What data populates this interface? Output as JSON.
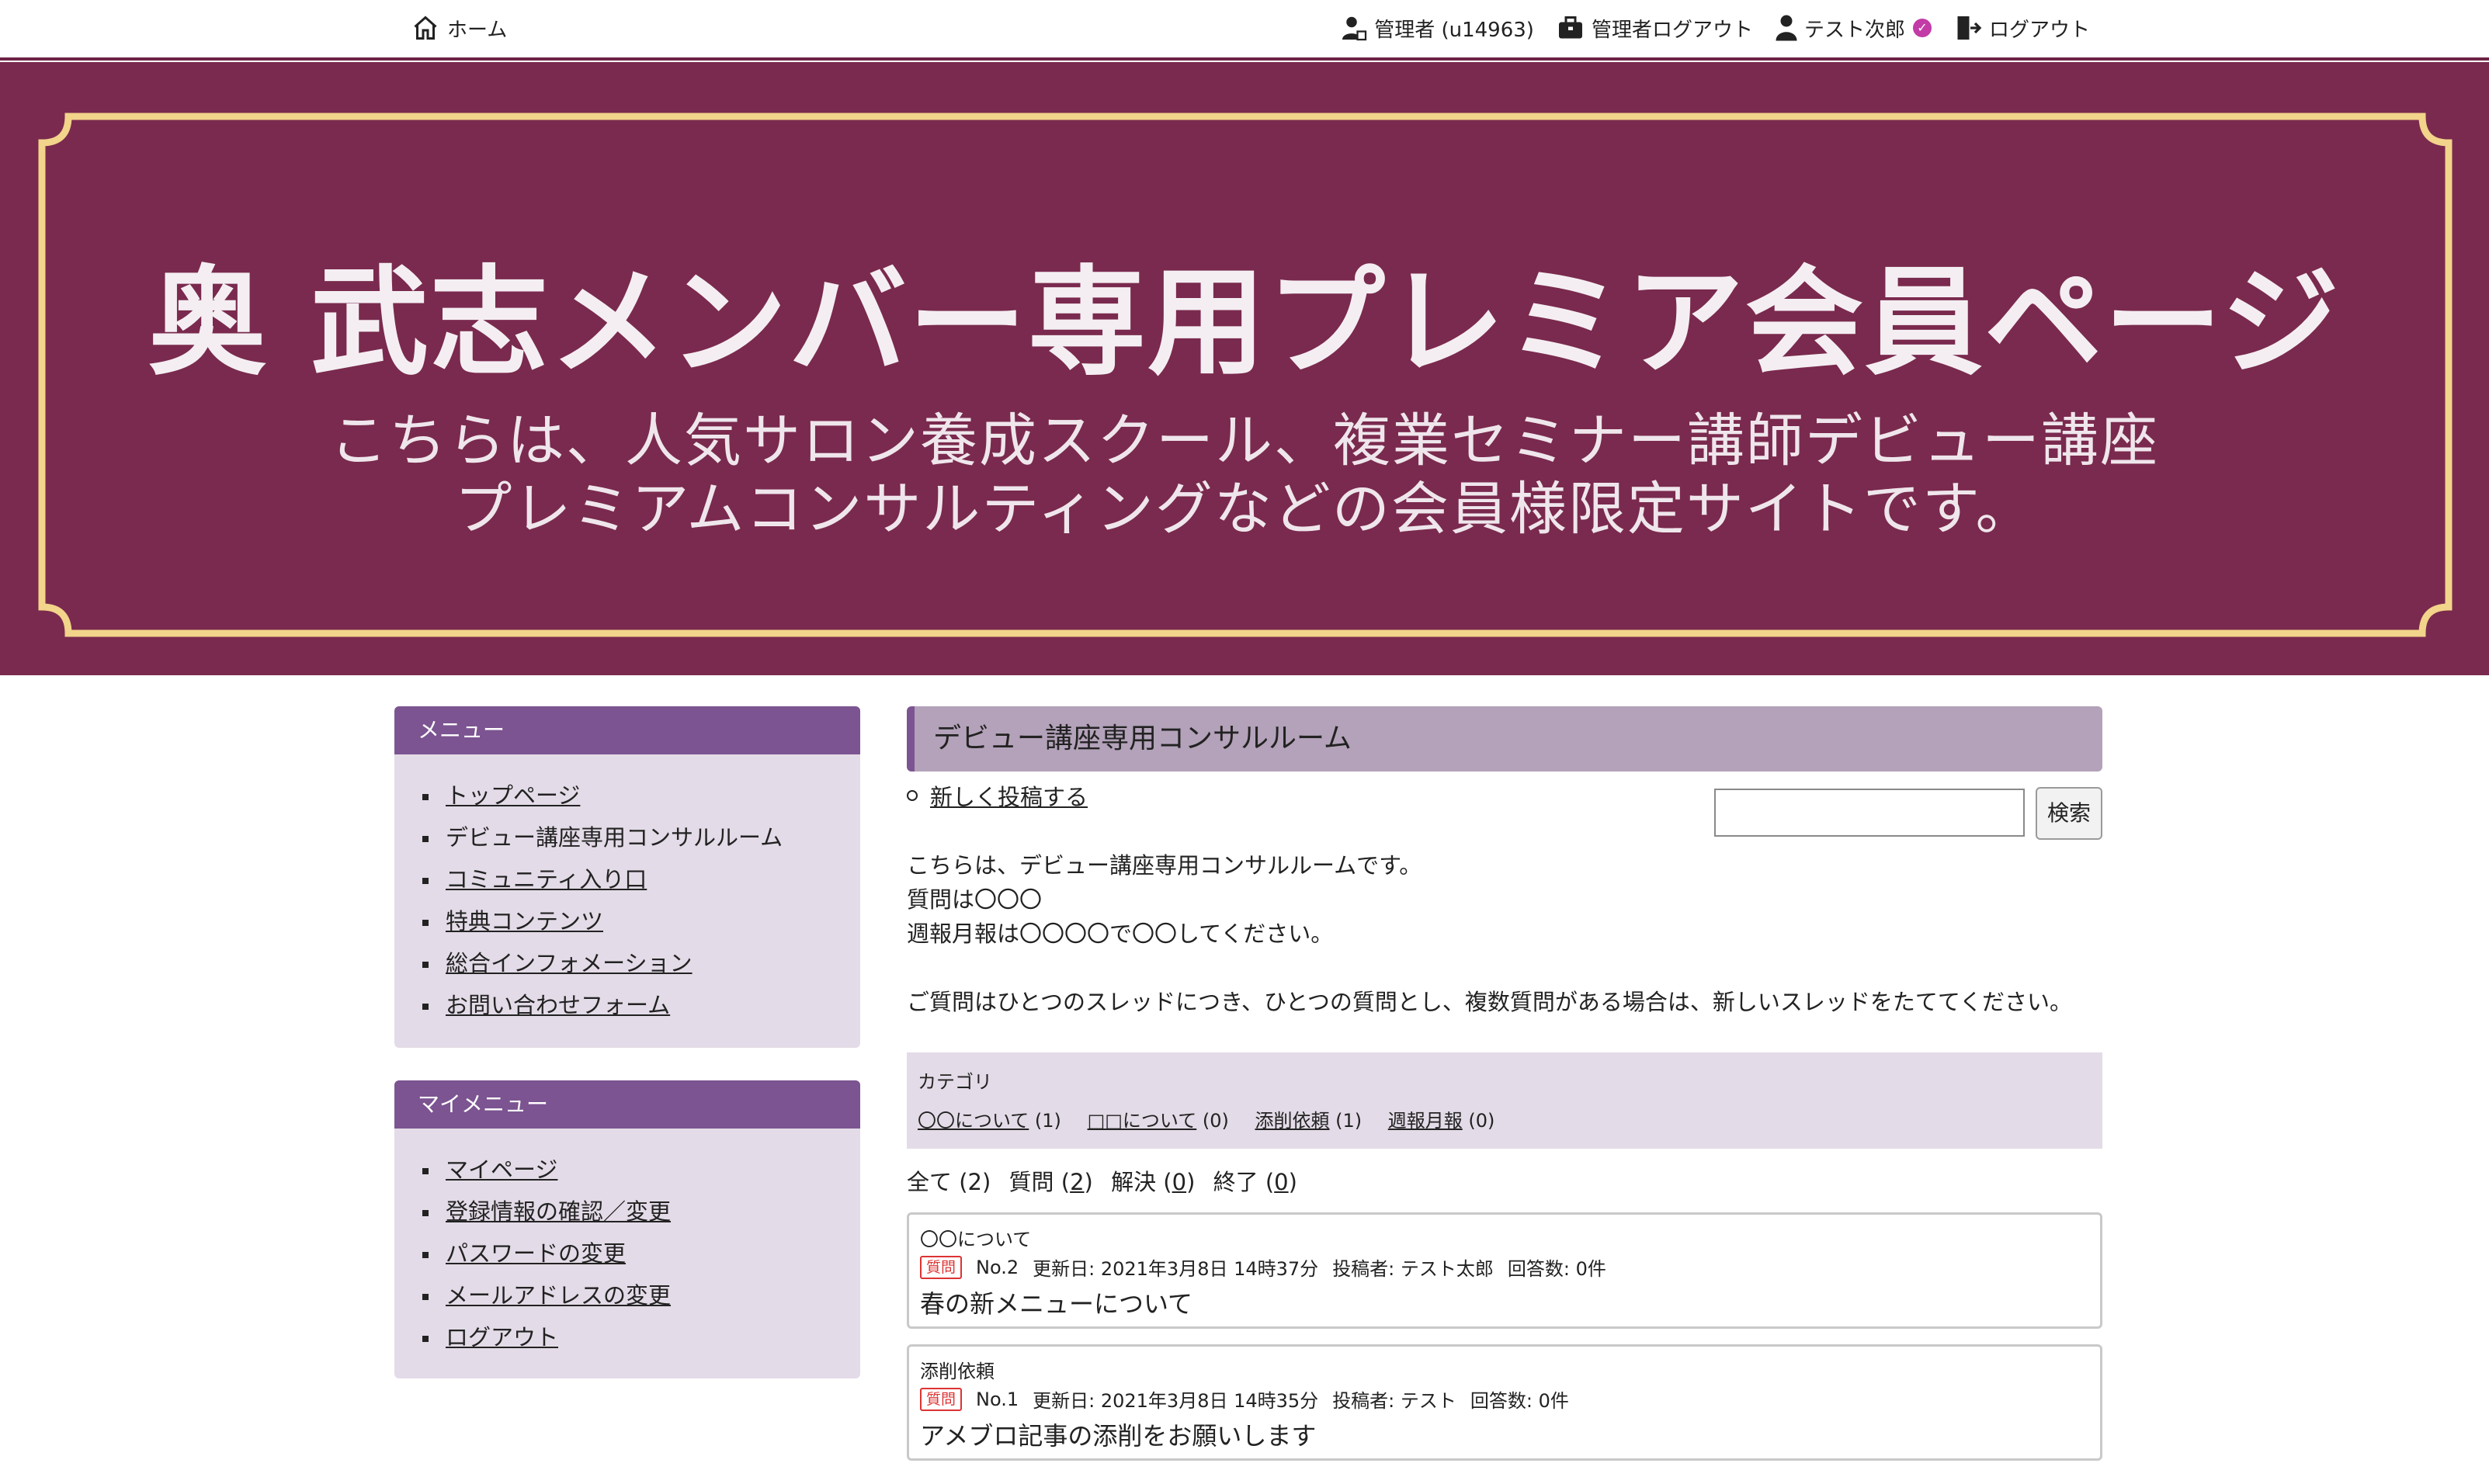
{
  "topbar": {
    "home": "ホーム",
    "admin_user": "管理者 (u14963)",
    "admin_logout": "管理者ログアウト",
    "user_name": "テスト次郎",
    "logout": "ログアウト"
  },
  "banner": {
    "title": "奥 武志メンバー専用プレミア会員ページ",
    "subtitle_line1": "こちらは、人気サロン養成スクール、複業セミナー講師デビュー講座",
    "subtitle_line2": "プレミアムコンサルティングなどの会員様限定サイトです。"
  },
  "sidebar": {
    "menu_title": "メニュー",
    "menu_items": [
      {
        "label": "トップページ",
        "link": true
      },
      {
        "label": "デビュー講座専用コンサルルーム",
        "link": false
      },
      {
        "label": "コミュニティ入り口",
        "link": true
      },
      {
        "label": "特典コンテンツ",
        "link": true
      },
      {
        "label": "総合インフォメーション",
        "link": true
      },
      {
        "label": "お問い合わせフォーム",
        "link": true
      }
    ],
    "mymenu_title": "マイメニュー",
    "mymenu_items": [
      {
        "label": "マイページ"
      },
      {
        "label": "登録情報の確認／変更"
      },
      {
        "label": "パスワードの変更"
      },
      {
        "label": "メールアドレスの変更"
      },
      {
        "label": "ログアウト"
      }
    ]
  },
  "main": {
    "room_title": "デビュー講座専用コンサルルーム",
    "new_post": "新しく投稿する",
    "search_button": "検索",
    "search_value": "",
    "desc_lines": [
      "こちらは、デビュー講座専用コンサルルームです。",
      "質問は〇〇〇",
      "週報月報は〇〇〇〇で〇〇してください。",
      "ご質問はひとつのスレッドにつき、ひとつの質問とし、複数質問がある場合は、新しいスレッドをたててください。"
    ],
    "category_title": "カテゴリ",
    "categories": [
      {
        "label": "〇〇について",
        "count": "(1)"
      },
      {
        "label": "□□について",
        "count": "(0)"
      },
      {
        "label": "添削依頼",
        "count": "(1)"
      },
      {
        "label": "週報月報",
        "count": "(0)"
      }
    ],
    "filters": {
      "all": "全て (2)",
      "question_label": "質問 (",
      "question_count": "2",
      "solved_label": "解決 (",
      "solved_count": "0",
      "closed_label": "終了 (",
      "closed_count": "0",
      "close_paren": ")"
    },
    "threads": [
      {
        "category": "〇〇について",
        "badge": "質問",
        "no": "No.2",
        "updated": "更新日: 2021年3月8日 14時37分",
        "author": "投稿者: テスト太郎",
        "replies": "回答数: 0件",
        "title": "春の新メニューについて"
      },
      {
        "category": "添削依頼",
        "badge": "質問",
        "no": "No.1",
        "updated": "更新日: 2021年3月8日 14時35分",
        "author": "投稿者: テスト",
        "replies": "回答数: 0件",
        "title": "アメブロ記事の添削をお願いします"
      }
    ]
  },
  "colors": {
    "banner_bg": "#7a2a4e",
    "frame_gold": "#f2d48a",
    "sidebar_head": "#7c5491",
    "sidebar_bg": "#e3dbe7",
    "room_head_bg": "#b3a2b9",
    "badge_red": "#dd3333"
  }
}
